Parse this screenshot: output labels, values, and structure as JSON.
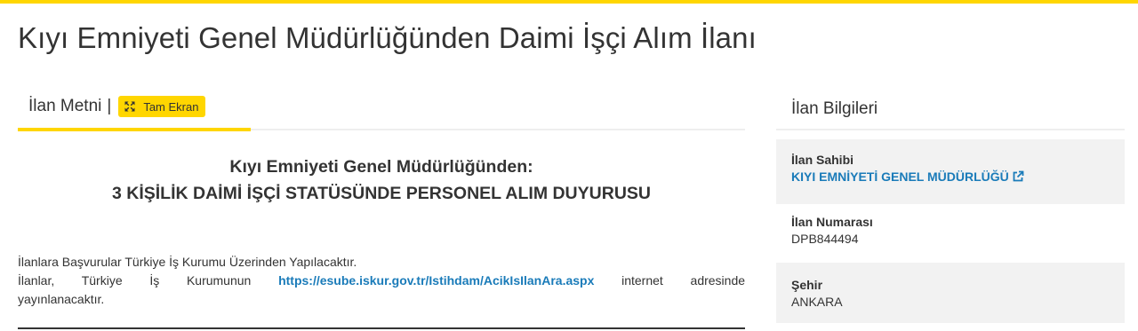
{
  "page": {
    "title": "Kıyı Emniyeti Genel Müdürlüğünden Daimi İşçi Alım İlanı"
  },
  "tabs": {
    "text_tab_label": "İlan Metni",
    "separator": "|",
    "fullscreen_label": "Tam Ekran",
    "fullscreen_icon": "expand-icon"
  },
  "document": {
    "heading_line1": "Kıyı Emniyeti Genel Müdürlüğünden:",
    "heading_line2": "3 KİŞİLİK DAİMİ İŞÇİ STATÜSÜNDE PERSONEL ALIM DUYURUSU",
    "para1": "İlanlara Başvurular Türkiye İş Kurumu Üzerinden Yapılacaktır.",
    "para2_before": "İlanlar, Türkiye İş Kurumunun",
    "para2_link": "https://esube.iskur.gov.tr/Istihdam/AcikIsIlanAra.aspx",
    "para2_after": "internet adresinde",
    "para2_end": "yayınlanacaktır."
  },
  "sidebar": {
    "title": "İlan Bilgileri",
    "owner_label": "İlan Sahibi",
    "owner_value": "KIYI EMNİYETİ GENEL MÜDÜRLÜĞÜ",
    "owner_icon": "external-link-icon",
    "number_label": "İlan Numarası",
    "number_value": "DPB844494",
    "city_label": "Şehir",
    "city_value": "ANKARA"
  },
  "colors": {
    "accent": "#ffd600",
    "link": "#1a7bb9",
    "panel_bg": "#f2f2f2",
    "text": "#333333"
  }
}
